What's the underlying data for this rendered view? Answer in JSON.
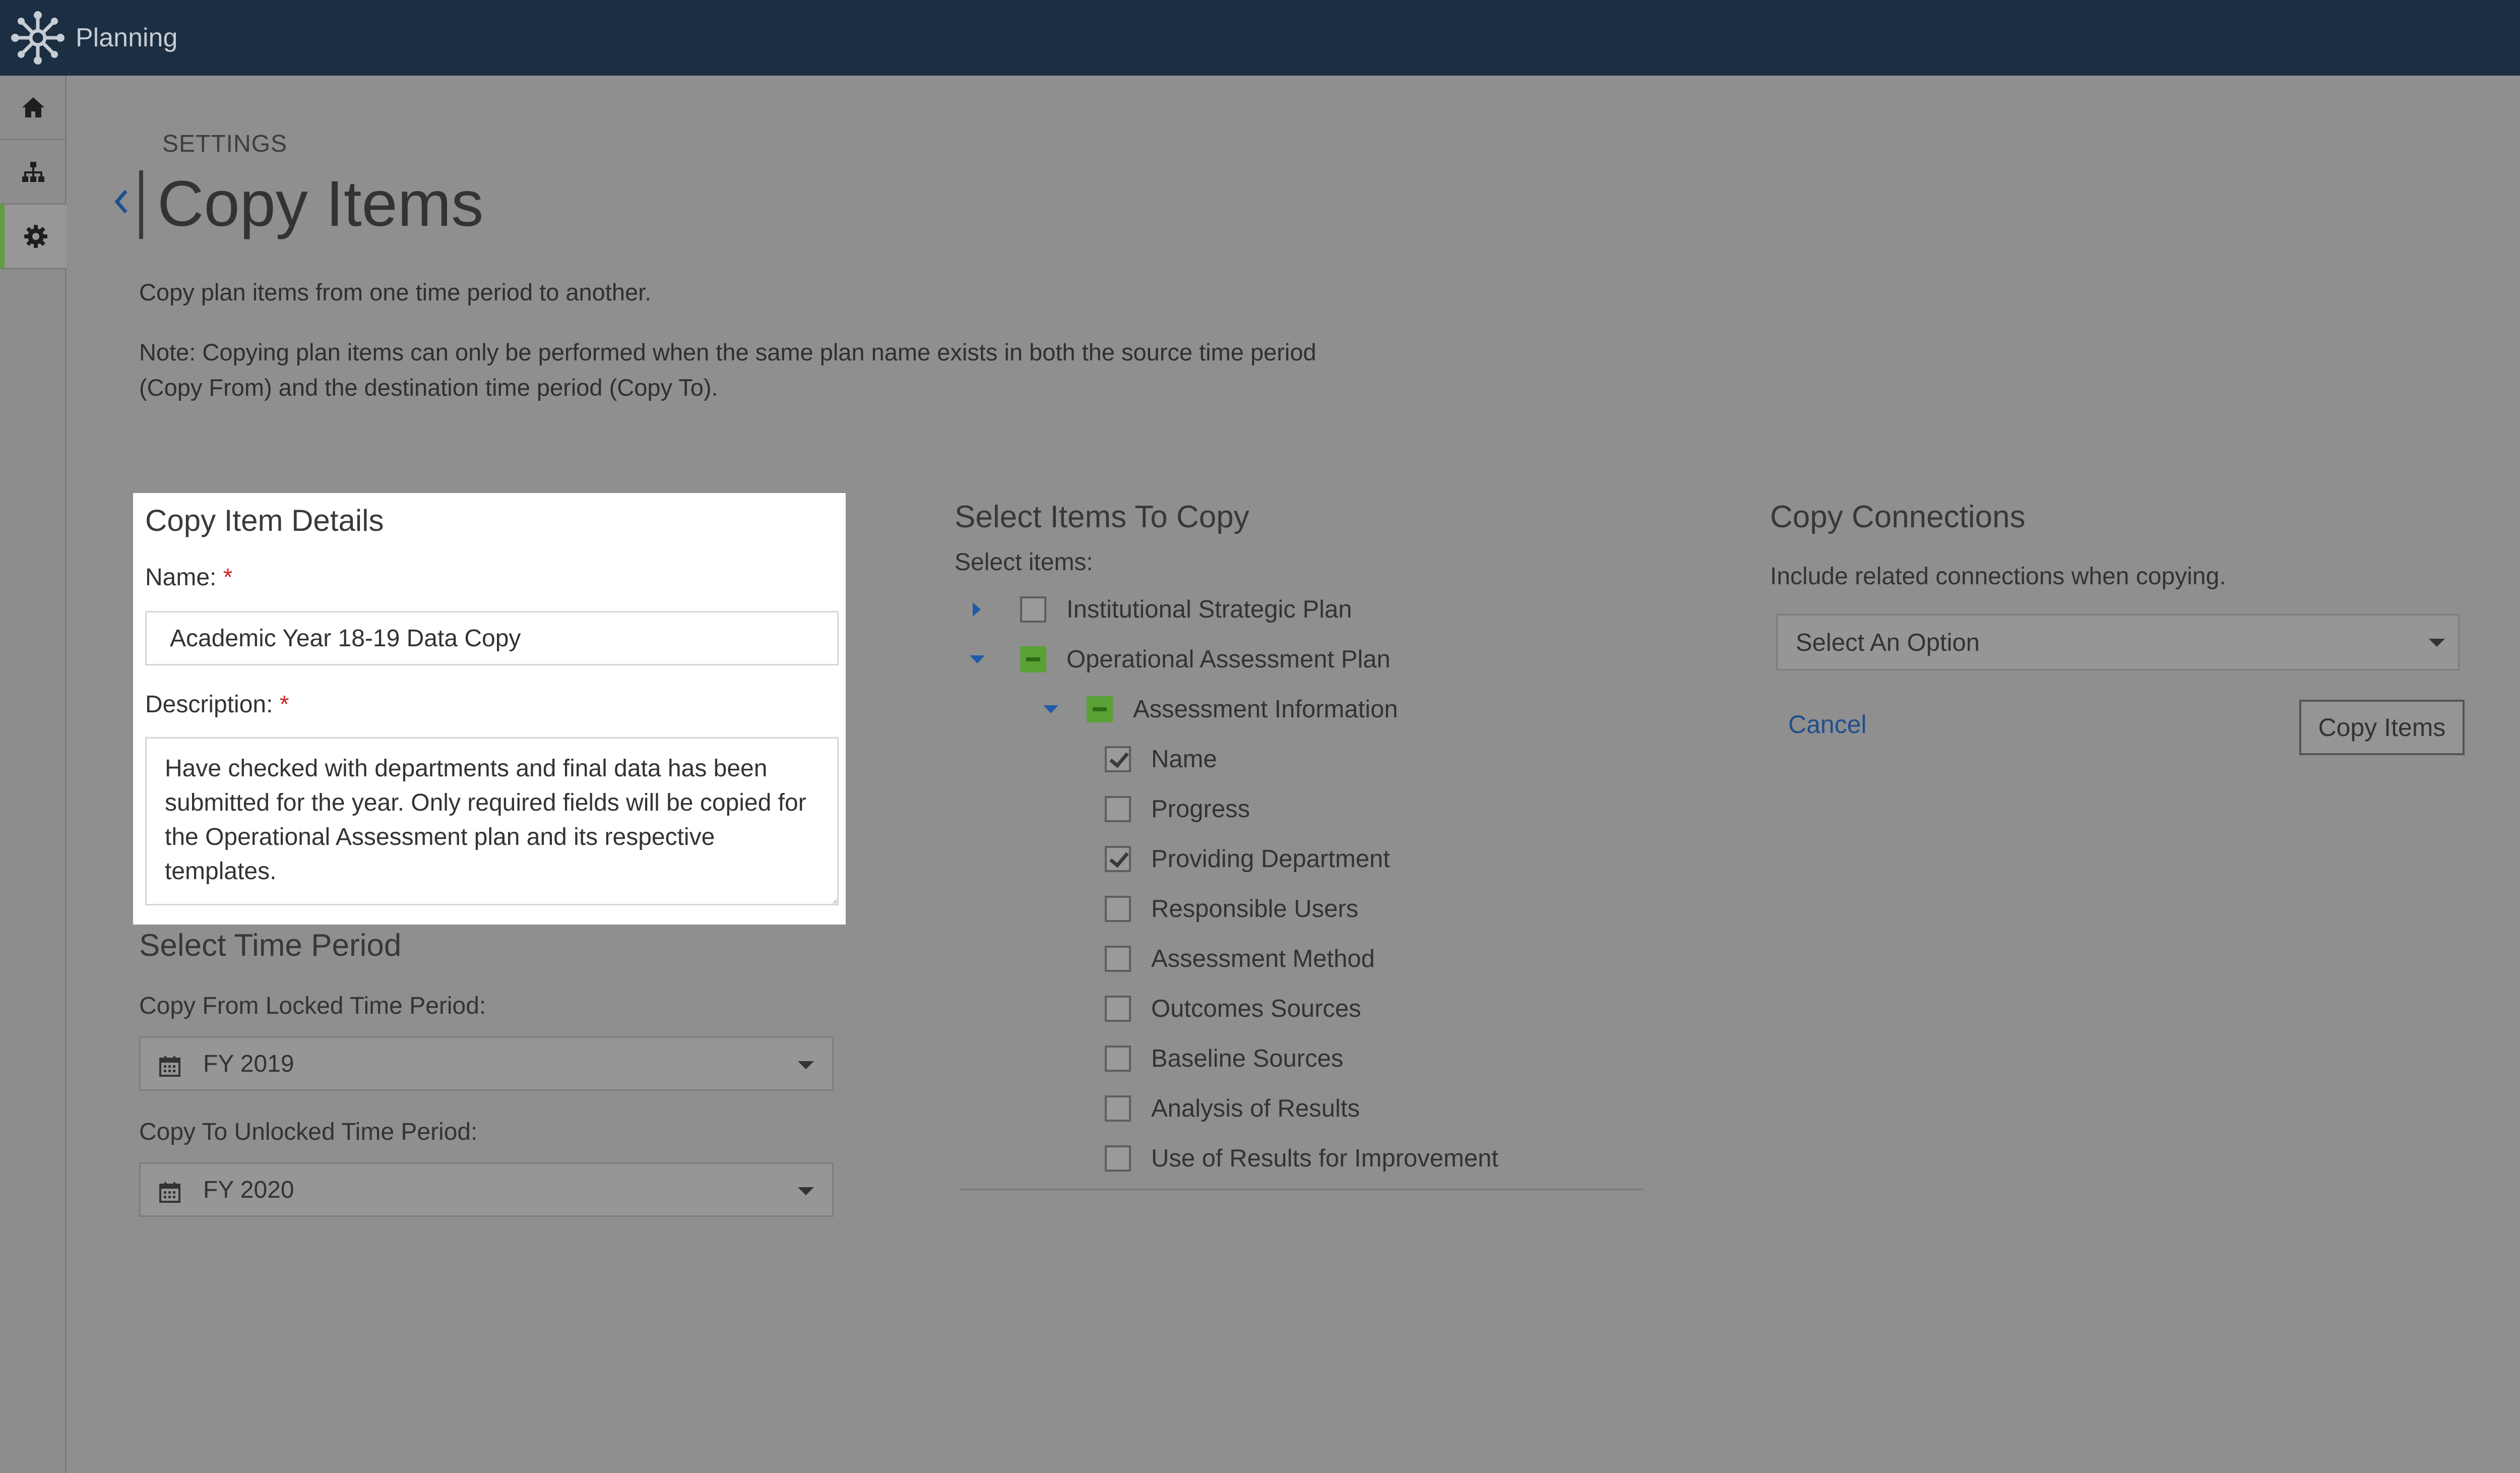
{
  "app": {
    "title": "Planning"
  },
  "sidebar": {
    "items": [
      {
        "icon": "home-icon"
      },
      {
        "icon": "org-chart-icon"
      },
      {
        "icon": "gear-icon",
        "active": true
      }
    ]
  },
  "breadcrumb": "SETTINGS",
  "page": {
    "title": "Copy Items",
    "intro": "Copy plan items from one time period to another.",
    "note_line1": "Note: Copying plan items can only be performed when the same plan name exists in both the source time period",
    "note_line2": "(Copy From) and the destination time period (Copy To)."
  },
  "details": {
    "heading": "Copy Item Details",
    "name_label": "Name:",
    "name_value": "Academic Year 18-19 Data Copy",
    "description_label": "Description:",
    "description_value": "Have checked with departments and final data has been submitted for the year. Only required fields will be copied for the Operational Assessment plan and its respective templates.",
    "required_mark": "*"
  },
  "time_period": {
    "heading": "Select Time Period",
    "from_label": "Copy From Locked Time Period:",
    "from_value": "FY 2019",
    "to_label": "Copy To Unlocked Time Period:",
    "to_value": "FY 2020"
  },
  "select_items": {
    "heading": "Select Items To Copy",
    "subheading": "Select items:",
    "tree": [
      {
        "label": "Institutional Strategic Plan",
        "state": "unchecked",
        "expanded": false
      },
      {
        "label": "Operational Assessment Plan",
        "state": "partial",
        "expanded": true
      },
      {
        "label": "Assessment Information",
        "state": "partial",
        "expanded": true
      },
      {
        "label": "Name",
        "state": "checked"
      },
      {
        "label": "Progress",
        "state": "unchecked"
      },
      {
        "label": "Providing Department",
        "state": "checked"
      },
      {
        "label": "Responsible Users",
        "state": "unchecked"
      },
      {
        "label": "Assessment Method",
        "state": "unchecked"
      },
      {
        "label": "Outcomes Sources",
        "state": "unchecked"
      },
      {
        "label": "Baseline Sources",
        "state": "unchecked"
      },
      {
        "label": "Analysis of Results",
        "state": "unchecked"
      },
      {
        "label": "Use of Results for Improvement",
        "state": "unchecked"
      }
    ]
  },
  "connections": {
    "heading": "Copy Connections",
    "description": "Include related connections when copying.",
    "select_value": "Select An Option",
    "cancel_label": "Cancel",
    "copy_label": "Copy Items"
  },
  "colors": {
    "topbar": "#1c2e42",
    "accent_green": "#5aa136",
    "link_blue": "#1f4f8c",
    "required_red": "#d0232a"
  }
}
